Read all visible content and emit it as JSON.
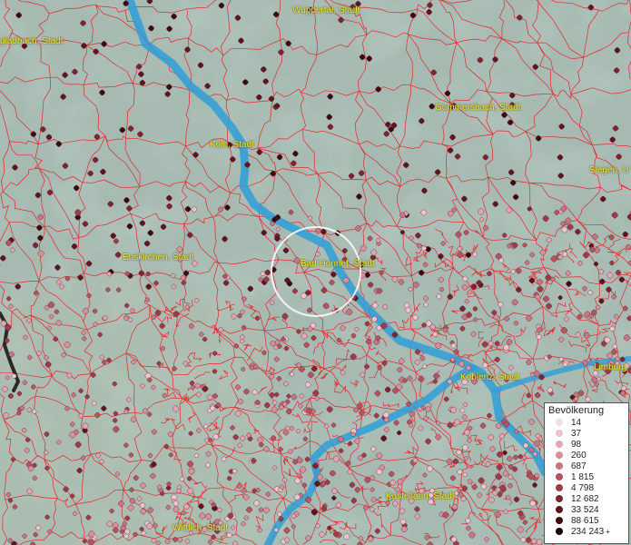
{
  "map": {
    "cities": [
      {
        "id": "wuppertal",
        "label": "Wuppertal, Stadt"
      },
      {
        "id": "gladbach",
        "label": "gladbach, Stadt"
      },
      {
        "id": "gummersbach",
        "label": "Gummersbach, Stadt"
      },
      {
        "id": "koeln",
        "label": "Köln, Stadt"
      },
      {
        "id": "siegen",
        "label": "Siegen, U"
      },
      {
        "id": "euskirchen",
        "label": "Euskirchen, Stadt"
      },
      {
        "id": "bad-honnef",
        "label": "Bad Honnef, Stadt"
      },
      {
        "id": "koblenz",
        "label": "Koblenz, Stadt"
      },
      {
        "id": "limburg",
        "label": "Limburg"
      },
      {
        "id": "kastellaun",
        "label": "Kastellaun, Stadt"
      },
      {
        "id": "wittlich",
        "label": "Wittlich, Stadt"
      }
    ],
    "colors": {
      "river": "#2f9fd6",
      "borders": "#e8262a",
      "terrain": "#9fb6ad"
    }
  },
  "legend": {
    "title": "Bevölkerung",
    "entries": [
      {
        "label": "14",
        "color": "#f6dde3"
      },
      {
        "label": "37",
        "color": "#eec3cd"
      },
      {
        "label": "98",
        "color": "#e2a6b1"
      },
      {
        "label": "260",
        "color": "#d98f9c"
      },
      {
        "label": "687",
        "color": "#c97482"
      },
      {
        "label": "1 815",
        "color": "#b5535f"
      },
      {
        "label": "4 798",
        "color": "#9d3c48"
      },
      {
        "label": "12 682",
        "color": "#7d2430"
      },
      {
        "label": "33 524",
        "color": "#5e1520"
      },
      {
        "label": "88 615",
        "color": "#3c0a11"
      },
      {
        "label": "234 243",
        "color": "#140204"
      }
    ],
    "plus_marker": "+"
  }
}
